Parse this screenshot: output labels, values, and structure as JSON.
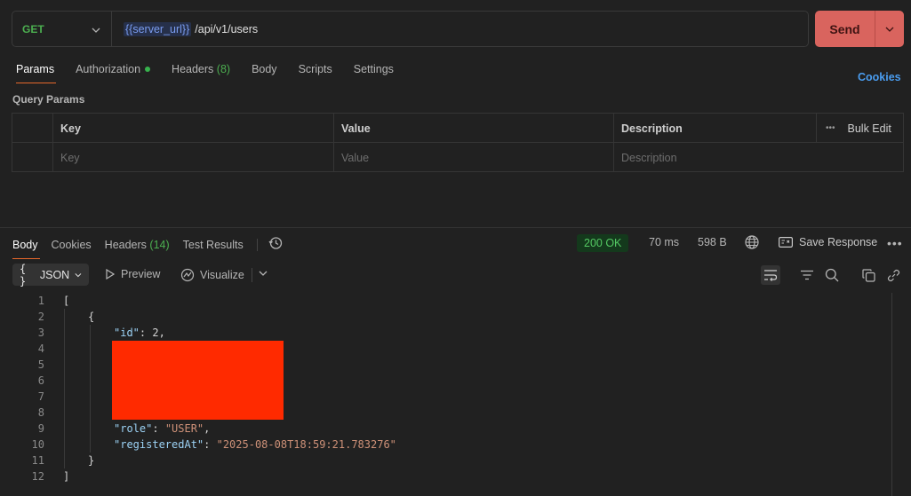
{
  "request": {
    "method": "GET",
    "url_variable": "{{server_url}}",
    "url_path": "/api/v1/users",
    "send_label": "Send"
  },
  "request_tabs": [
    {
      "label": "Params",
      "count": ""
    },
    {
      "label": "Authorization",
      "count": ""
    },
    {
      "label": "Headers",
      "count": "(8)"
    },
    {
      "label": "Body",
      "count": ""
    },
    {
      "label": "Scripts",
      "count": ""
    },
    {
      "label": "Settings",
      "count": ""
    }
  ],
  "cookies_label": "Cookies",
  "query_params": {
    "title": "Query Params",
    "headers": {
      "key": "Key",
      "value": "Value",
      "description": "Description",
      "bulk_edit": "Bulk Edit"
    },
    "placeholders": {
      "key": "Key",
      "value": "Value",
      "description": "Description"
    }
  },
  "response_tabs": [
    {
      "label": "Body",
      "count": ""
    },
    {
      "label": "Cookies",
      "count": ""
    },
    {
      "label": "Headers",
      "count": "(14)"
    },
    {
      "label": "Test Results",
      "count": ""
    }
  ],
  "response_meta": {
    "status": "200 OK",
    "time": "70 ms",
    "size": "598 B",
    "save_response": "Save Response"
  },
  "toolbar": {
    "format": "JSON",
    "format_braces": "{ }",
    "preview": "Preview",
    "visualize": "Visualize"
  },
  "code_lines": [
    {
      "n": "1",
      "text": "["
    },
    {
      "n": "2",
      "text": "{"
    },
    {
      "n": "3",
      "key": "\"id\"",
      "rest": ": 2,"
    },
    {
      "n": "4"
    },
    {
      "n": "5"
    },
    {
      "n": "6"
    },
    {
      "n": "7"
    },
    {
      "n": "8"
    },
    {
      "n": "9",
      "key": "\"role\"",
      "rest": ": ",
      "str": "\"USER\"",
      "tail": ","
    },
    {
      "n": "10",
      "key": "\"registeredAt\"",
      "rest": ": ",
      "str": "\"2025-08-08T18:59:21.783276\"",
      "tail": ""
    },
    {
      "n": "11",
      "text": "}"
    },
    {
      "n": "12",
      "text": "]"
    }
  ],
  "colors": {
    "accent": "#e6672b",
    "send": "#d9645e",
    "status_ok": "#54c963",
    "redaction": "#ff2a00"
  }
}
